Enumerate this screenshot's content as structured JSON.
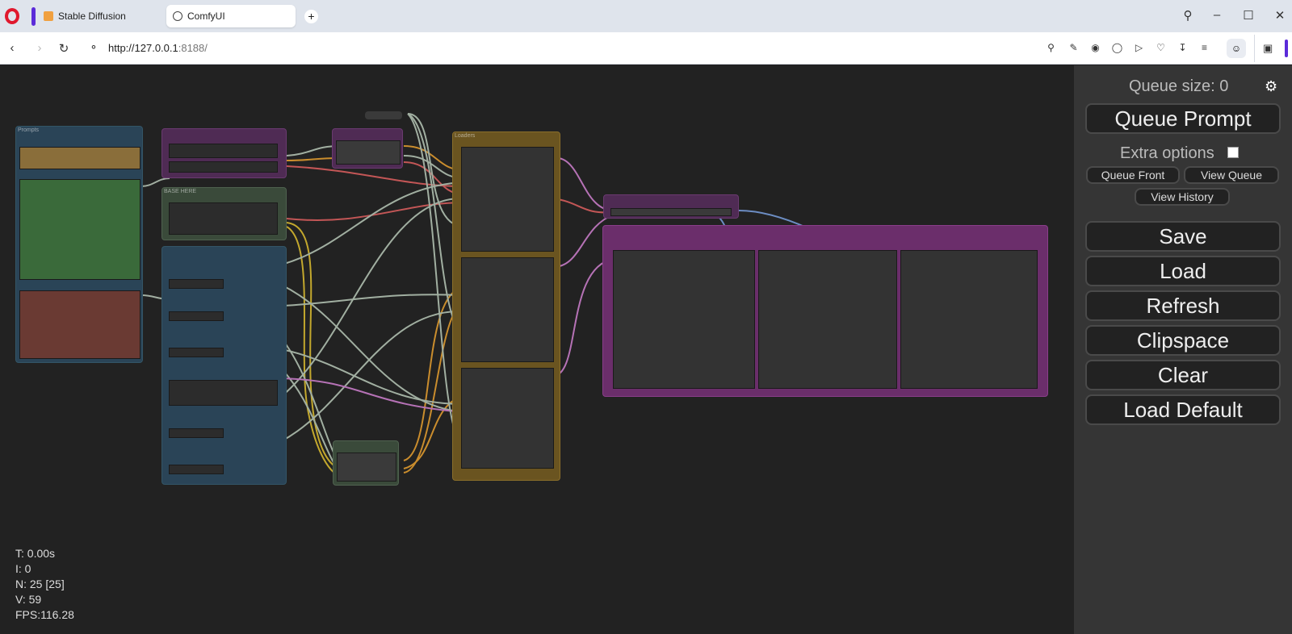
{
  "browser": {
    "tabs": [
      {
        "label": "Stable Diffusion",
        "icon": "stable-diffusion-icon"
      },
      {
        "label": "ComfyUI",
        "icon": "globe-icon",
        "active": true
      }
    ],
    "url_host": "http://127.0.0.1",
    "url_port": ":8188/",
    "new_tab": "+"
  },
  "canvas": {
    "stats": {
      "time": "T: 0.00s",
      "iterations": "I: 0",
      "nodes": "N: 25 [25]",
      "vertices": "V: 59",
      "fps": "FPS:116.28"
    },
    "node_colors": {
      "blue": "#2a4457",
      "purple": "#4f2b54",
      "green": "#3a4a3a",
      "gold": "#6a5420",
      "pink": "#6b2e6b"
    }
  },
  "sidemenu": {
    "queue_size": "Queue size: 0",
    "queue_prompt": "Queue Prompt",
    "extra_options": "Extra options",
    "queue_front": "Queue Front",
    "view_queue": "View Queue",
    "view_history": "View History",
    "save": "Save",
    "load": "Load",
    "refresh": "Refresh",
    "clipspace": "Clipspace",
    "clear": "Clear",
    "load_default": "Load Default"
  }
}
